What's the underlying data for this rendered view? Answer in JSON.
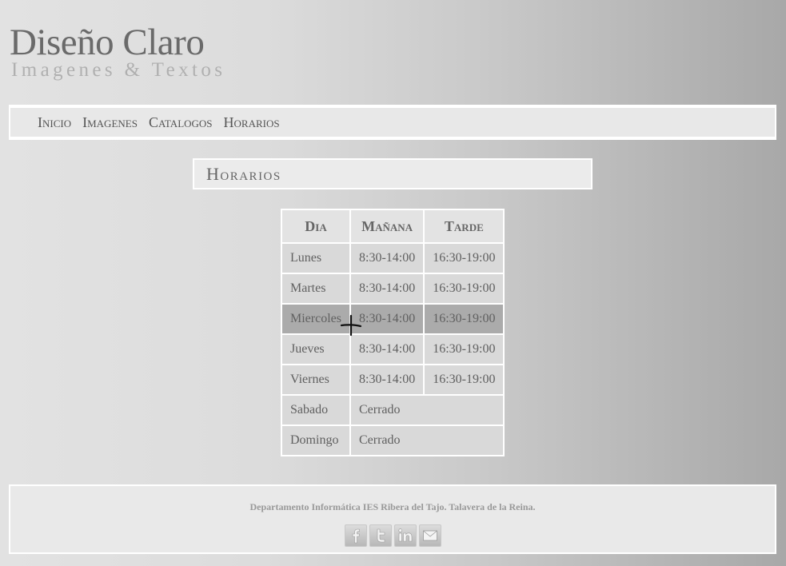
{
  "logo": {
    "title": "Diseño Claro",
    "subtitle": "Imagenes & Textos"
  },
  "nav": {
    "items": [
      {
        "label": "Inicio"
      },
      {
        "label": "Imagenes"
      },
      {
        "label": "Catalogos"
      },
      {
        "label": "Horarios"
      }
    ]
  },
  "page": {
    "title": "Horarios"
  },
  "schedule": {
    "headers": [
      "Dia",
      "Mañana",
      "Tarde"
    ],
    "rows": [
      {
        "day": "Lunes",
        "morning": "8:30-14:00",
        "afternoon": "16:30-19:00"
      },
      {
        "day": "Martes",
        "morning": "8:30-14:00",
        "afternoon": "16:30-19:00"
      },
      {
        "day": "Miercoles",
        "morning": "8:30-14:00",
        "afternoon": "16:30-19:00"
      },
      {
        "day": "Jueves",
        "morning": "8:30-14:00",
        "afternoon": "16:30-19:00"
      },
      {
        "day": "Viernes",
        "morning": "8:30-14:00",
        "afternoon": "16:30-19:00"
      },
      {
        "day": "Sabado",
        "closed": "Cerrado"
      },
      {
        "day": "Domingo",
        "closed": "Cerrado"
      }
    ]
  },
  "footer": {
    "text": "Departamento Informática IES Ribera del Tajo. Talavera de la Reina.",
    "social_icons": [
      "facebook-icon",
      "twitter-icon",
      "linkedin-icon",
      "email-icon"
    ]
  },
  "colors": {
    "table_cell": "#d9d9d9",
    "table_highlight": "#ababab",
    "border": "#ffffff",
    "text": "#606060"
  }
}
